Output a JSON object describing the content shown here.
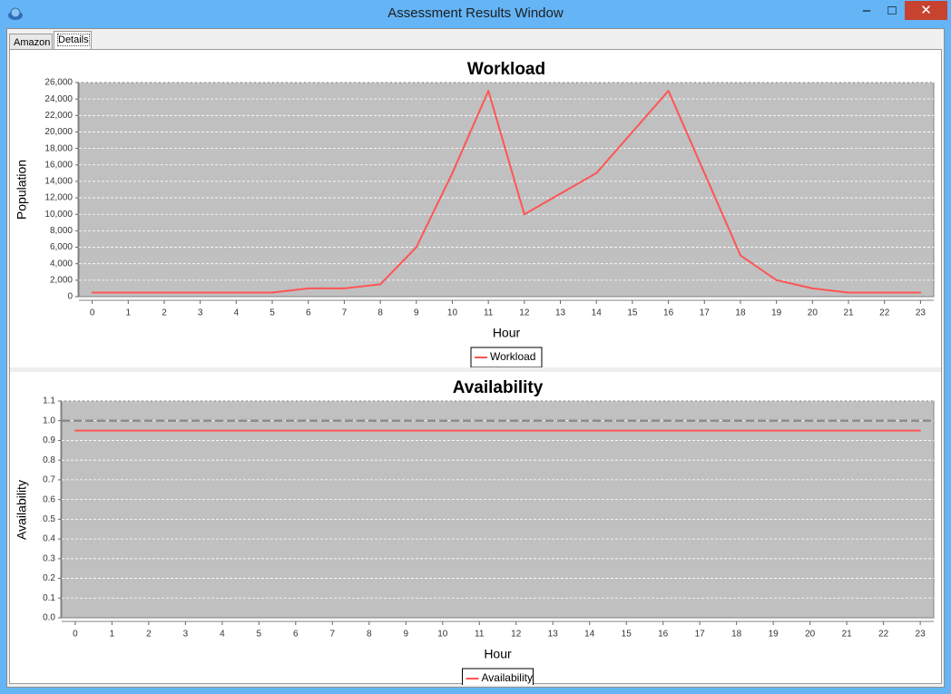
{
  "window": {
    "title": "Assessment Results Window",
    "minimize": "–",
    "maximize": "□",
    "close": "✕"
  },
  "tabs": [
    {
      "label": "Amazon",
      "selected": false
    },
    {
      "label": "Details",
      "selected": true
    }
  ],
  "colors": {
    "series": "#ff5555",
    "plot_background": "#c0c0c0",
    "gridline": "#ffffff",
    "reference_line": "#8c8c8c"
  },
  "chart_data": [
    {
      "type": "line",
      "title": "Workload",
      "xlabel": "Hour",
      "ylabel": "Population",
      "x": [
        0,
        1,
        2,
        3,
        4,
        5,
        6,
        7,
        8,
        9,
        10,
        11,
        12,
        13,
        14,
        15,
        16,
        17,
        18,
        19,
        20,
        21,
        22,
        23
      ],
      "xticks": [
        "0",
        "1",
        "2",
        "3",
        "4",
        "5",
        "6",
        "7",
        "8",
        "9",
        "10",
        "11",
        "12",
        "13",
        "14",
        "15",
        "16",
        "17",
        "18",
        "19",
        "20",
        "21",
        "22",
        "23"
      ],
      "ylim": [
        0,
        26000
      ],
      "yticks": [
        "0",
        "2,000",
        "4,000",
        "6,000",
        "8,000",
        "10,000",
        "12,000",
        "14,000",
        "16,000",
        "18,000",
        "20,000",
        "22,000",
        "24,000",
        "26,000"
      ],
      "grid": true,
      "legend_position": "bottom",
      "series": [
        {
          "name": "Workload",
          "values": [
            500,
            500,
            500,
            500,
            500,
            500,
            1000,
            1000,
            1500,
            6000,
            15000,
            25000,
            10000,
            12500,
            15000,
            20000,
            25000,
            15000,
            5000,
            2000,
            1000,
            500,
            500,
            500
          ]
        }
      ]
    },
    {
      "type": "line",
      "title": "Availability",
      "xlabel": "Hour",
      "ylabel": "Availability",
      "x": [
        0,
        1,
        2,
        3,
        4,
        5,
        6,
        7,
        8,
        9,
        10,
        11,
        12,
        13,
        14,
        15,
        16,
        17,
        18,
        19,
        20,
        21,
        22,
        23
      ],
      "xticks": [
        "0",
        "1",
        "2",
        "3",
        "4",
        "5",
        "6",
        "7",
        "8",
        "9",
        "10",
        "11",
        "12",
        "13",
        "14",
        "15",
        "16",
        "17",
        "18",
        "19",
        "20",
        "21",
        "22",
        "23"
      ],
      "ylim": [
        0,
        1.1
      ],
      "yticks": [
        "0.0",
        "0.1",
        "0.2",
        "0.3",
        "0.4",
        "0.5",
        "0.6",
        "0.7",
        "0.8",
        "0.9",
        "1.0",
        "1.1"
      ],
      "grid": true,
      "legend_position": "bottom",
      "reference_line_y": 1.0,
      "series": [
        {
          "name": "Availability",
          "values": [
            0.95,
            0.95,
            0.95,
            0.95,
            0.95,
            0.95,
            0.95,
            0.95,
            0.95,
            0.95,
            0.95,
            0.95,
            0.95,
            0.95,
            0.95,
            0.95,
            0.95,
            0.95,
            0.95,
            0.95,
            0.95,
            0.95,
            0.95,
            0.95
          ]
        }
      ]
    }
  ]
}
